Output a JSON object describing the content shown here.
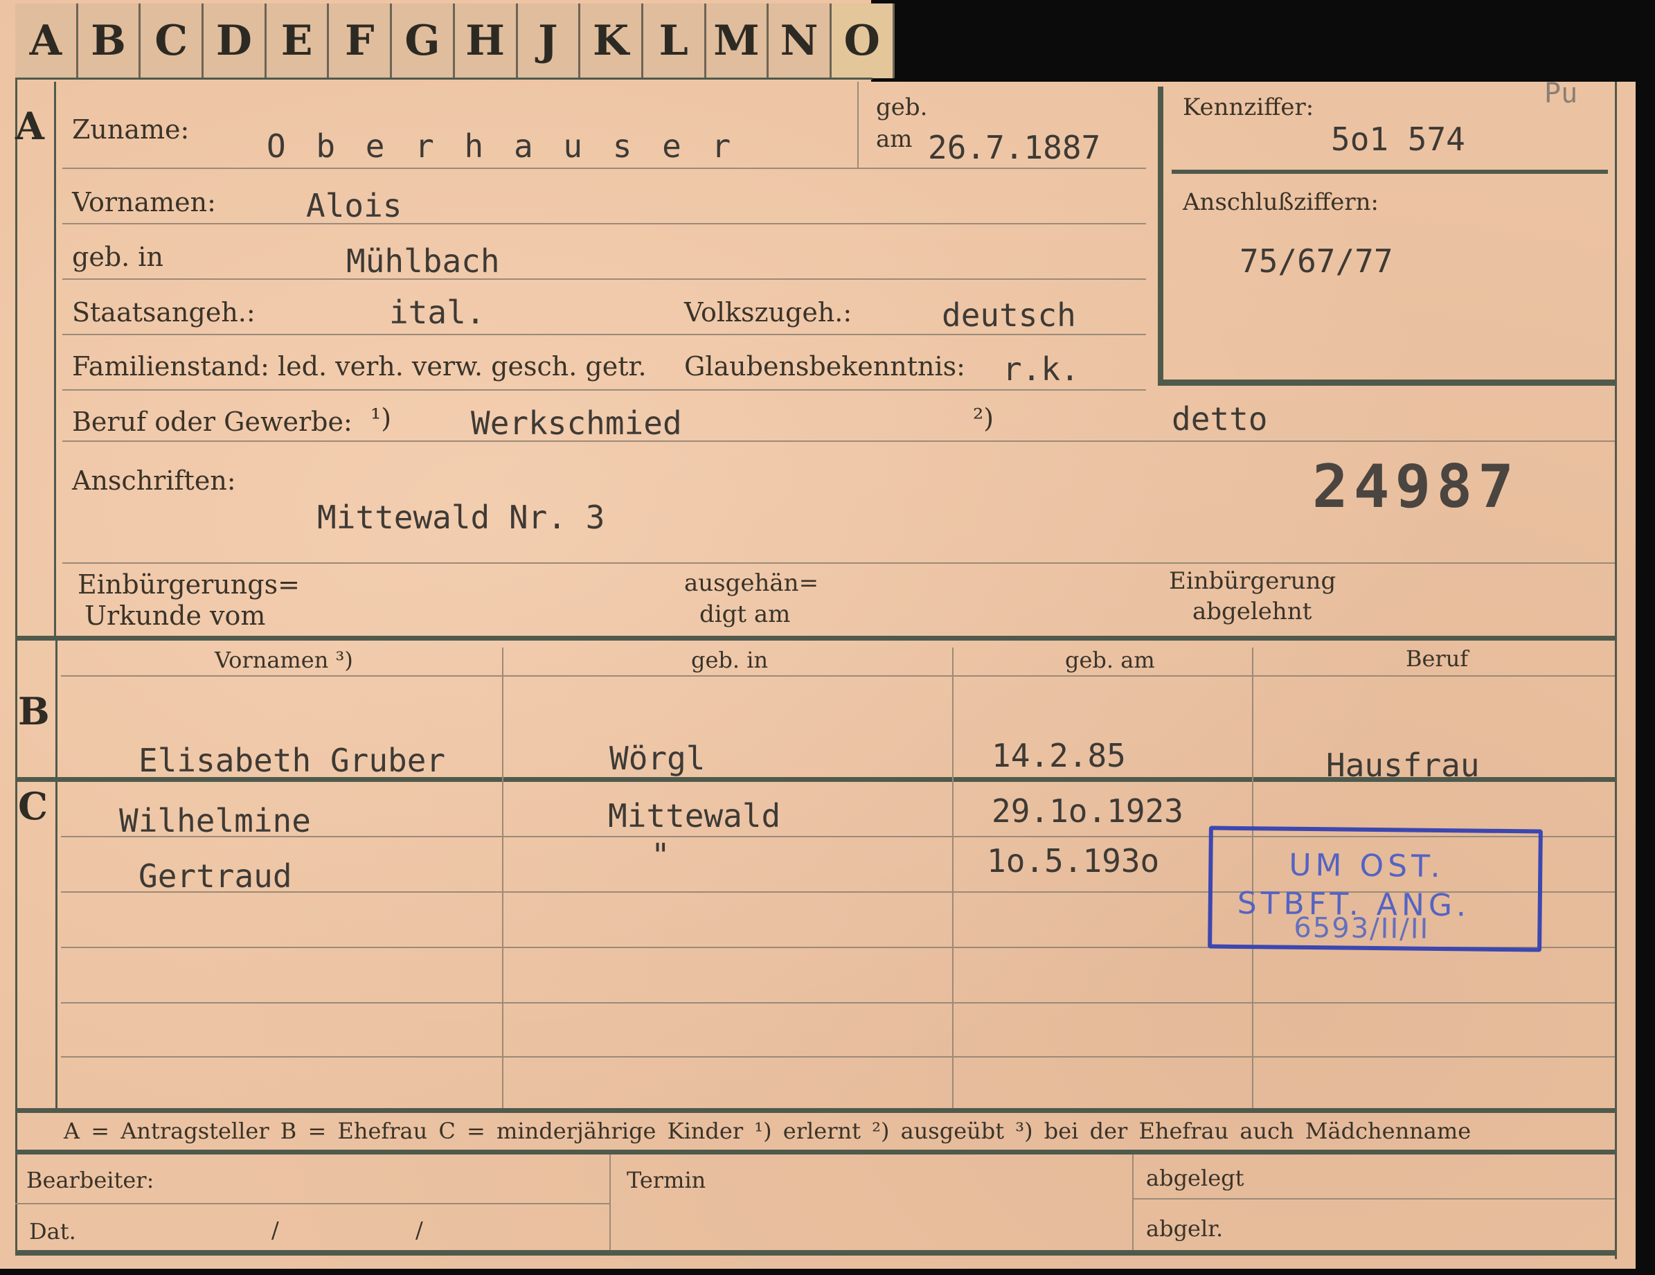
{
  "tabs": [
    "A",
    "B",
    "C",
    "D",
    "E",
    "F",
    "G",
    "H",
    "J",
    "K",
    "L",
    "M",
    "N",
    "O"
  ],
  "sections": {
    "a": "A",
    "b": "B",
    "c": "C"
  },
  "labels": {
    "zuname": "Zuname:",
    "geb": "geb.",
    "am": "am",
    "kennziffer": "Kennziffer:",
    "vornamen": "Vornamen:",
    "anschlussziffern": "Anschlußziffern:",
    "geb_in": "geb. in",
    "staatsangeh": "Staatsangeh.:",
    "volkszugeh": "Volkszugeh.:",
    "familienstand": "Familienstand: led. verh. verw. gesch. getr.",
    "glaubensbekenntnis": "Glaubensbekenntnis:",
    "beruf": "Beruf oder Gewerbe:",
    "fn1": "¹)",
    "fn2": "²)",
    "anschriften": "Anschriften:",
    "einbuergerung_urkunde_1": "Einbürgerungs=",
    "einbuergerung_urkunde_2": "Urkunde vom",
    "ausgehaendigt_1": "ausgehän=",
    "ausgehaendigt_2": "digt am",
    "einbuergerung_abgelehnt_1": "Einbürgerung",
    "einbuergerung_abgelehnt_2": "abgelehnt"
  },
  "applicant": {
    "surname": "O b e r h a u s e r",
    "birth_date": "26.7.1887",
    "kennziffer": "5o1 574",
    "corner_mark": "Pu",
    "first_names": "Alois",
    "anschlussziffern": "75/67/77",
    "birthplace": "Mühlbach",
    "citizenship": "ital.",
    "ethnicity": "deutsch",
    "religion": "r.k.",
    "occupation_learned": "Werkschmied",
    "occupation_practiced": "detto",
    "address": "Mittewald Nr. 3",
    "file_number": "24987"
  },
  "table": {
    "headers": [
      "Vornamen ³)",
      "geb. in",
      "geb. am",
      "Beruf"
    ],
    "spouse": {
      "name": "Elisabeth Gruber",
      "birthplace": "Wörgl",
      "birth_date": "14.2.85",
      "occupation": "Hausfrau"
    },
    "children": [
      {
        "name": "Wilhelmine",
        "birthplace": "Mittewald",
        "birth_date": "29.1o.1923"
      },
      {
        "name": "Gertraud",
        "birthplace": "\"",
        "birth_date": "1o.5.193o"
      }
    ]
  },
  "stamp": {
    "line1": "UM OST.",
    "line2": "STBFT. ANG.",
    "ref": "6593/II/II"
  },
  "legend": "A = Antragsteller   B = Ehefrau   C = minderjährige Kinder   ¹) erlernt   ²) ausgeübt   ³) bei der Ehefrau auch Mädchenname",
  "footer": {
    "bearbeiter": "Bearbeiter:",
    "dat": "Dat.",
    "slash": "/",
    "termin": "Termin",
    "abgelegt": "abgelegt",
    "abgelr": "abgelr."
  }
}
